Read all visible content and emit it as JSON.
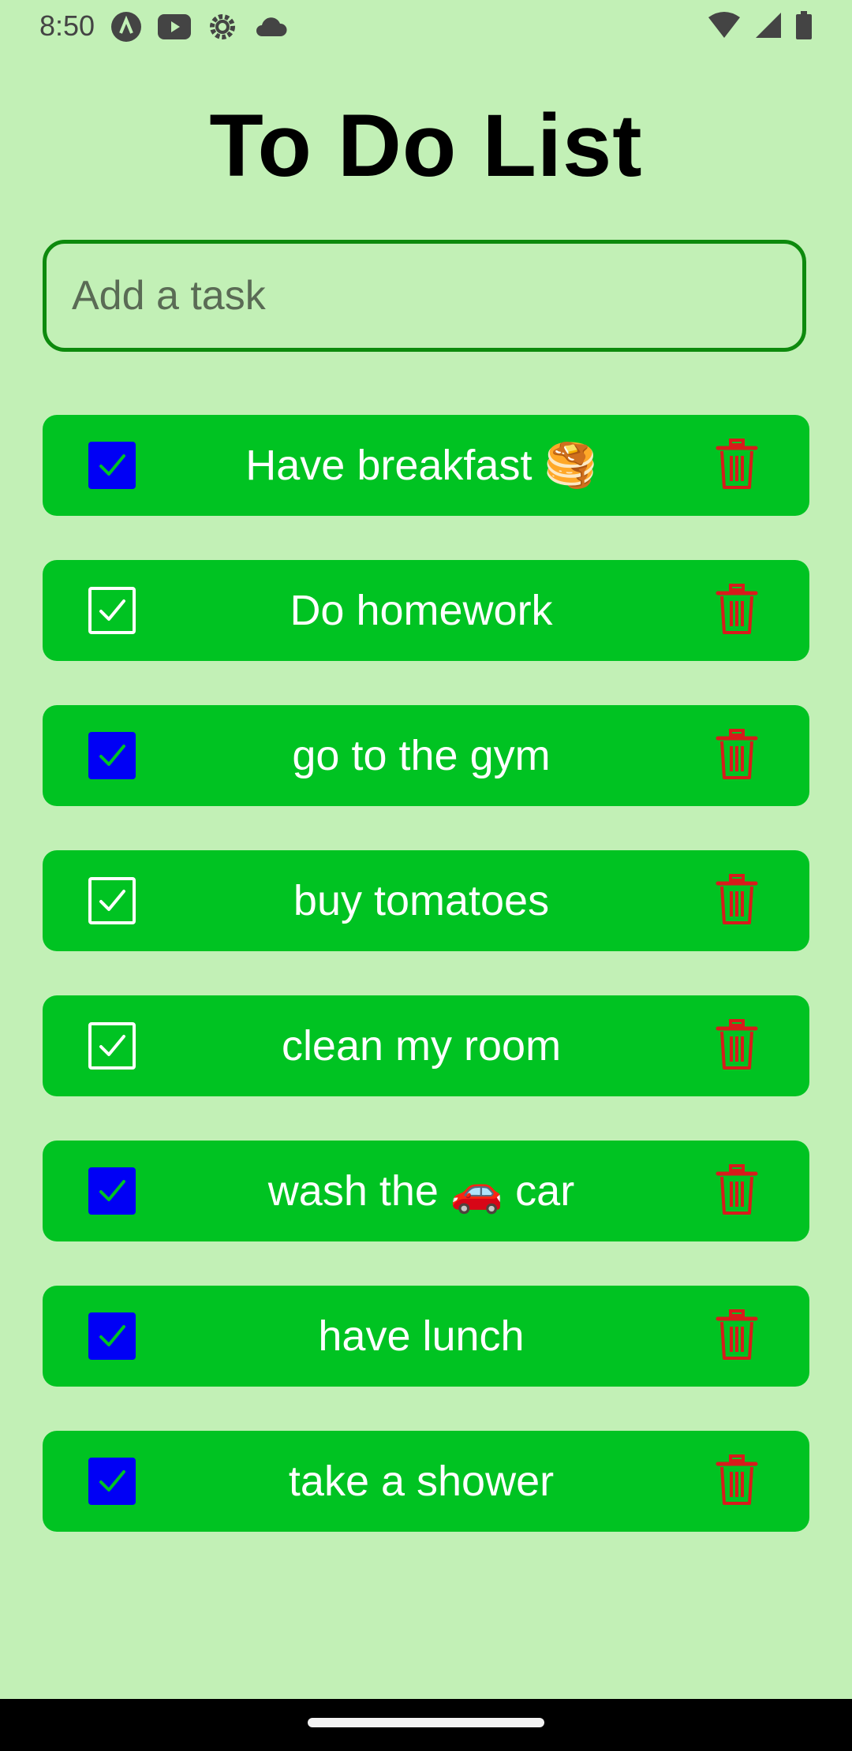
{
  "status_bar": {
    "time": "8:50",
    "left_icons": [
      "a-circle-icon",
      "youtube-icon",
      "settings-gear-icon",
      "cloud-icon"
    ],
    "right_icons": [
      "wifi-icon",
      "signal-icon",
      "battery-icon"
    ]
  },
  "title": "To Do List",
  "task_input": {
    "placeholder": "Add a task",
    "value": ""
  },
  "tasks": [
    {
      "label": "Have breakfast 🥞",
      "checked": true
    },
    {
      "label": "Do homework",
      "checked": false
    },
    {
      "label": "go to the gym",
      "checked": true
    },
    {
      "label": "buy tomatoes",
      "checked": false
    },
    {
      "label": "clean my room",
      "checked": false
    },
    {
      "label": "wash the 🚗 car",
      "checked": true
    },
    {
      "label": "have lunch",
      "checked": true
    },
    {
      "label": "take a shower",
      "checked": true
    }
  ],
  "colors": {
    "background": "#c2f0b6",
    "row": "#00c322",
    "checkbox_checked": "#0000f5",
    "check_mark_checked": "#00c322",
    "delete_icon": "#d81b1b",
    "input_border": "#0d8a0d"
  }
}
